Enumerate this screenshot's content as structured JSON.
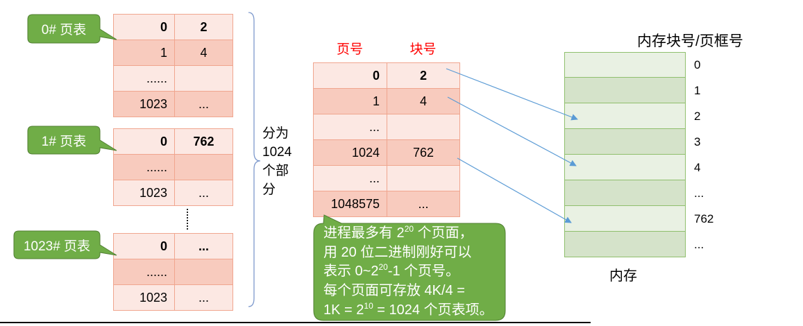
{
  "page_tables": [
    {
      "label": "0# 页表",
      "rows": [
        [
          "0",
          "2"
        ],
        [
          "1",
          "4"
        ],
        [
          "......",
          ""
        ],
        [
          "1023",
          "..."
        ]
      ]
    },
    {
      "label": "1# 页表",
      "rows": [
        [
          "0",
          "762"
        ],
        [
          "......",
          ""
        ],
        [
          "1023",
          "..."
        ]
      ]
    },
    {
      "label": "1023# 页表",
      "rows": [
        [
          "0",
          "..."
        ],
        [
          "......",
          ""
        ],
        [
          "1023",
          "..."
        ]
      ]
    }
  ],
  "split_label": [
    "分为",
    "1024",
    "个部",
    "分"
  ],
  "outer_table": {
    "headers": [
      "页号",
      "块号"
    ],
    "rows": [
      [
        "0",
        "2"
      ],
      [
        "1",
        "4"
      ],
      [
        "...",
        ""
      ],
      [
        "1024",
        "762"
      ],
      [
        "...",
        ""
      ],
      [
        "1048575",
        "..."
      ]
    ]
  },
  "note": {
    "lines": [
      {
        "pre": "进程最多有 2",
        "sup": "20",
        "post": " 个页面，"
      },
      {
        "pre": "用 20 位二进制刚好可以"
      },
      {
        "pre": "表示 0~2",
        "sup": "20",
        "post": "-1 个页号。"
      },
      {
        "pre": "每个页面可存放 4K/4 ="
      },
      {
        "pre": "1K = 2",
        "sup": "10",
        "post": " = 1024 个页表项。"
      }
    ]
  },
  "memory": {
    "title": "内存块号/页框号",
    "block_labels": [
      "0",
      "1",
      "2",
      "3",
      "4",
      "...",
      "762",
      "..."
    ],
    "caption": "内存"
  },
  "colors": {
    "callout_fill": "#70ad47",
    "callout_border": "#507e32",
    "table_row_light": "#fce8e3",
    "table_row_dark": "#f8cbbe",
    "table_border": "#f0a58e",
    "header_text": "#ff0000",
    "arrow": "#5b9bd5",
    "brace": "#7c98cc",
    "memory_light": "#e9f1e3",
    "memory_dark": "#d5e3ca",
    "memory_border": "#8fbf6c"
  }
}
